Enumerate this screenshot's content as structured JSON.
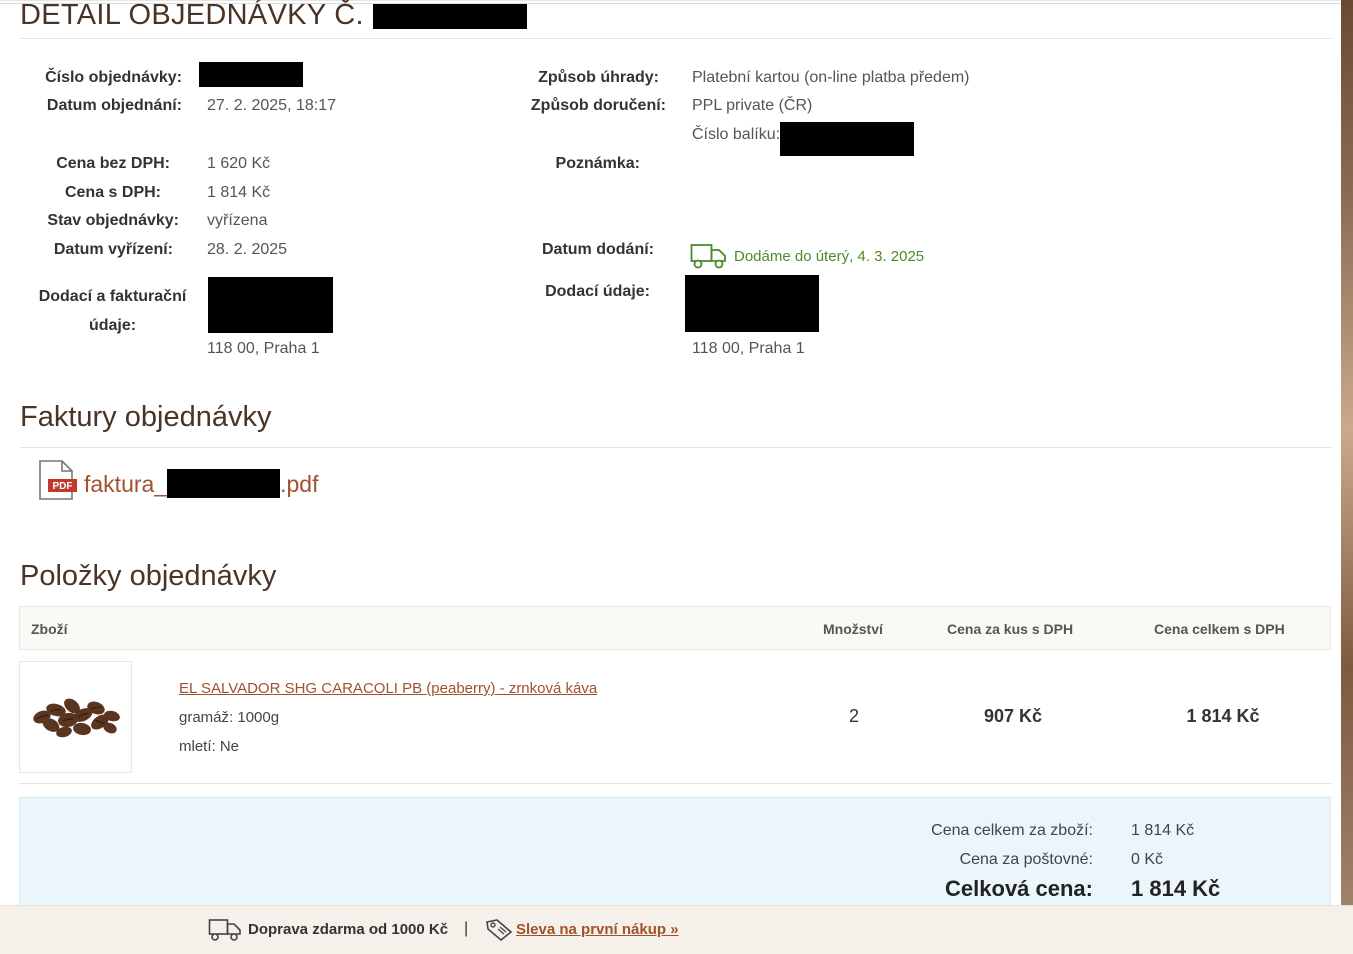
{
  "header": {
    "title": "DETAIL OBJEDNÁVKY Č."
  },
  "order": {
    "left": [
      {
        "label": "Číslo objednávky:",
        "value": ""
      },
      {
        "label": "Datum objednání:",
        "value": "27. 2. 2025, 18:17"
      },
      {
        "label": "Cena bez DPH:",
        "value": "1 620 Kč"
      },
      {
        "label": "Cena s DPH:",
        "value": "1 814 Kč"
      },
      {
        "label": "Stav objednávky:",
        "value": "vyřízena"
      },
      {
        "label": "Datum vyřízení:",
        "value": "28. 2. 2025"
      },
      {
        "label_line1": "Dodací a fakturační",
        "label_line2": "údaje:",
        "value": "118 00, Praha 1"
      }
    ],
    "right": [
      {
        "label": "Způsob úhrady:",
        "value": "Platební kartou (on-line platba předem)"
      },
      {
        "label": "Způsob doručení:",
        "value": "PPL private (ČR)"
      },
      {
        "label": "",
        "value": "Číslo balíku:"
      },
      {
        "label": "Poznámka:",
        "value": ""
      },
      {
        "label": "Datum dodání:",
        "value": "Dodáme do úterý, 4. 3. 2025"
      },
      {
        "label": "Dodací údaje:",
        "value": "118 00, Praha 1"
      }
    ]
  },
  "invoices": {
    "title": "Faktury objednávky",
    "file_prefix": "faktura_",
    "file_suffix": ".pdf",
    "pdf_badge": "PDF"
  },
  "items": {
    "title": "Položky objednávky",
    "columns": [
      "Zboží",
      "Množství",
      "Cena za kus s DPH",
      "Cena celkem s DPH"
    ],
    "rows": [
      {
        "name": "EL SALVADOR SHG CARACOLI PB (peaberry) - zrnková káva",
        "attr1": "gramáž: 1000g",
        "attr2": "mletí: Ne",
        "qty": "2",
        "unit_price": "907 Kč",
        "total_price": "1 814 Kč"
      }
    ]
  },
  "summary": {
    "goods_label": "Cena celkem za zboží:",
    "goods_value": "1 814 Kč",
    "shipping_label": "Cena za poštovné:",
    "shipping_value": "0 Kč",
    "total_label": "Celková cena:",
    "total_value": "1 814 Kč"
  },
  "footer": {
    "shipping_text": "Doprava zdarma od 1000 Kč",
    "separator": "|",
    "discount_link": "Sleva na první nákup »"
  },
  "colors": {
    "accent": "#a0522d",
    "heading": "#4a3426",
    "delivery_green": "#4a8a2c",
    "summary_bg": "#eaf6fb"
  }
}
